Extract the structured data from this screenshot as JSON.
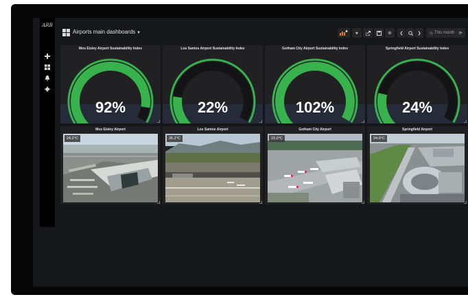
{
  "app": {
    "logo_text": "ARB",
    "dashboard_title": "Airports main dashboards",
    "time_range": "This month"
  },
  "sidebar": {
    "items": [
      {
        "icon": "plus-icon"
      },
      {
        "icon": "dashboards-icon"
      },
      {
        "icon": "bell-icon"
      },
      {
        "icon": "gear-icon"
      }
    ]
  },
  "toolbar": {
    "buttons": [
      "add-panel-icon",
      "star-icon",
      "share-icon",
      "save-icon",
      "gear-icon",
      "chevron-left-icon",
      "zoom-out-icon",
      "chevron-right-icon",
      "clock-icon",
      "refresh-icon"
    ]
  },
  "colors": {
    "gauge_fill": "#37b24d",
    "gauge_threshold_red": "#e0752d",
    "panel_bg": "#212124",
    "page_bg": "#161719"
  },
  "gauges": [
    {
      "title": "Mos Eisley Airport Sustainability Index",
      "value": 92,
      "label": "92%"
    },
    {
      "title": "Los Santos Airport Sustainability Index",
      "value": 22,
      "label": "22%"
    },
    {
      "title": "Gotham City Airport Sustainability Index",
      "value": 102,
      "label": "102%"
    },
    {
      "title": "Springfield Airport Sustainability Index",
      "value": 24,
      "label": "24%"
    }
  ],
  "airports": [
    {
      "title": "Mos Eisley Airport",
      "temperature": "24.2°C"
    },
    {
      "title": "Los Santos Airport",
      "temperature": "26.2°C"
    },
    {
      "title": "Gotham City Airport",
      "temperature": "23.0°C"
    },
    {
      "title": "Springfield Airport",
      "temperature": "24.9°C"
    }
  ]
}
